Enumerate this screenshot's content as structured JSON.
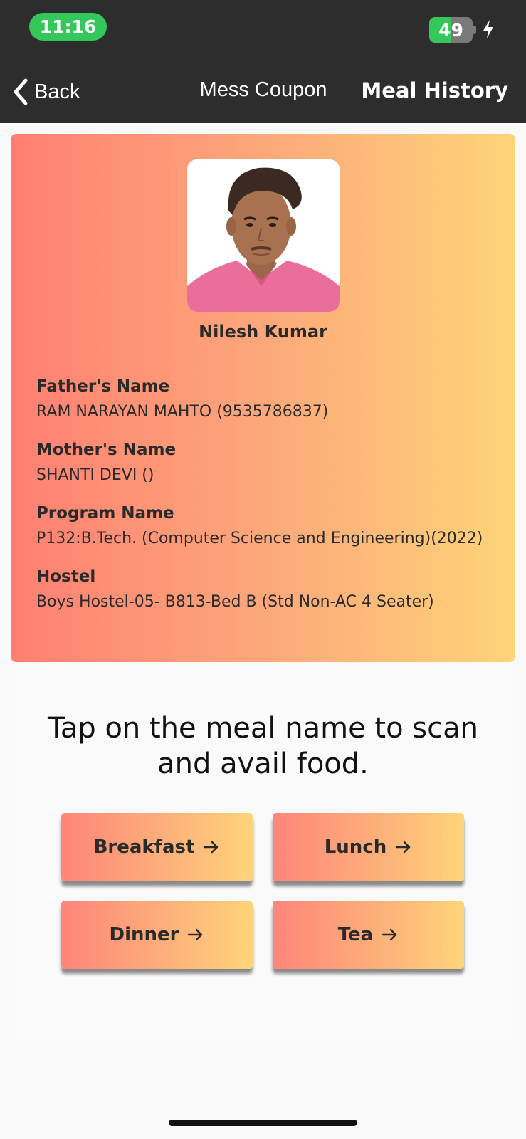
{
  "status_bar": {
    "time": "11:16",
    "battery_level": "49",
    "battery_fraction": 0.49,
    "icons": [
      "battery-icon",
      "charging-bolt-icon"
    ]
  },
  "nav": {
    "back_label": "Back",
    "title": "Mess Coupon",
    "history_label": "Meal History"
  },
  "profile": {
    "name": "Nilesh Kumar",
    "fields": [
      {
        "label": "Father's Name",
        "value": "RAM NARAYAN MAHTO (9535786837)"
      },
      {
        "label": "Mother's Name",
        "value": "SHANTI DEVI ()"
      },
      {
        "label": "Program Name",
        "value": "P132:B.Tech. (Computer Science and Engineering)(2022)"
      },
      {
        "label": "Hostel",
        "value": "Boys Hostel-05- B813-Bed B (Std Non-AC 4 Seater)"
      }
    ]
  },
  "instruction_line1": "Tap on the meal name to scan",
  "instruction_line2": "and avail food.",
  "meals": [
    {
      "label": "Breakfast"
    },
    {
      "label": "Lunch"
    },
    {
      "label": "Dinner"
    },
    {
      "label": "Tea"
    }
  ],
  "colors": {
    "header_bg": "#2d2d2d",
    "gradient_start": "#ff7f72",
    "gradient_end": "#fed478",
    "status_green": "#34c759"
  }
}
